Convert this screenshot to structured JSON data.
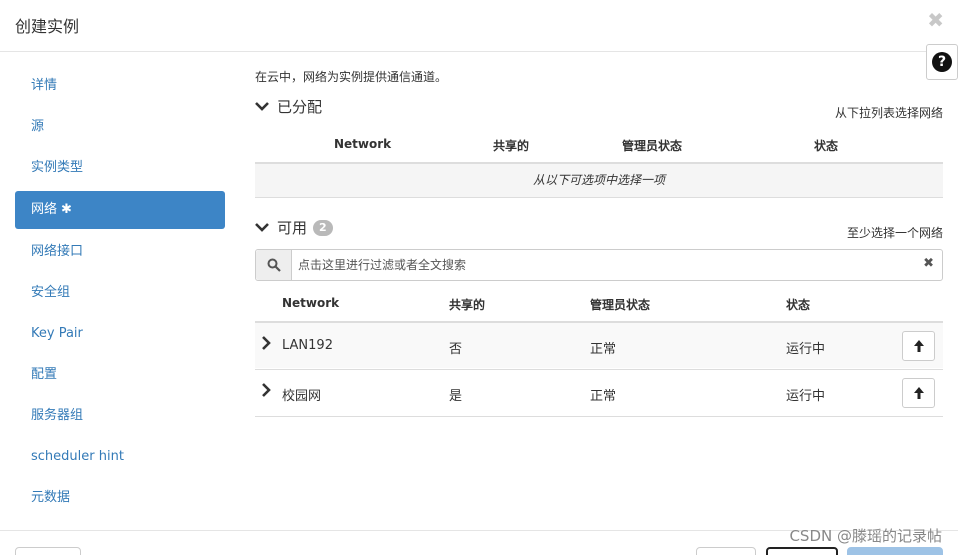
{
  "dialog": {
    "title": "创建实例",
    "close_glyph": "✖",
    "help_glyph": "?"
  },
  "sidebar": {
    "items": [
      {
        "label": "详情"
      },
      {
        "label": "源"
      },
      {
        "label": "实例类型"
      },
      {
        "label": "网络",
        "required_mark": "✱",
        "active": true
      },
      {
        "label": "网络接口"
      },
      {
        "label": "安全组"
      },
      {
        "label": "Key Pair"
      },
      {
        "label": "配置"
      },
      {
        "label": "服务器组"
      },
      {
        "label": "scheduler hint"
      },
      {
        "label": "元数据"
      }
    ]
  },
  "main": {
    "intro": "在云中，网络为实例提供通信通道。",
    "allocated": {
      "title": "已分配",
      "hint": "从下拉列表选择网络",
      "columns": [
        "Network",
        "共享的",
        "管理员状态",
        "状态"
      ],
      "empty_text": "从以下可选项中选择一项"
    },
    "available": {
      "title": "可用",
      "count": "2",
      "hint": "至少选择一个网络",
      "search_placeholder": "点击这里进行过滤或者全文搜索",
      "columns": [
        "Network",
        "共享的",
        "管理员状态",
        "状态"
      ],
      "rows": [
        {
          "network": "LAN192",
          "shared": "否",
          "admin_state": "正常",
          "status": "运行中"
        },
        {
          "network": "校园网",
          "shared": "是",
          "admin_state": "正常",
          "status": "运行中"
        }
      ]
    }
  },
  "watermark": "CSDN @滕瑶的记录帖",
  "colors": {
    "active_nav": "#3d85c6",
    "link": "#337ab7",
    "primary_button": "#9ec3e6"
  }
}
